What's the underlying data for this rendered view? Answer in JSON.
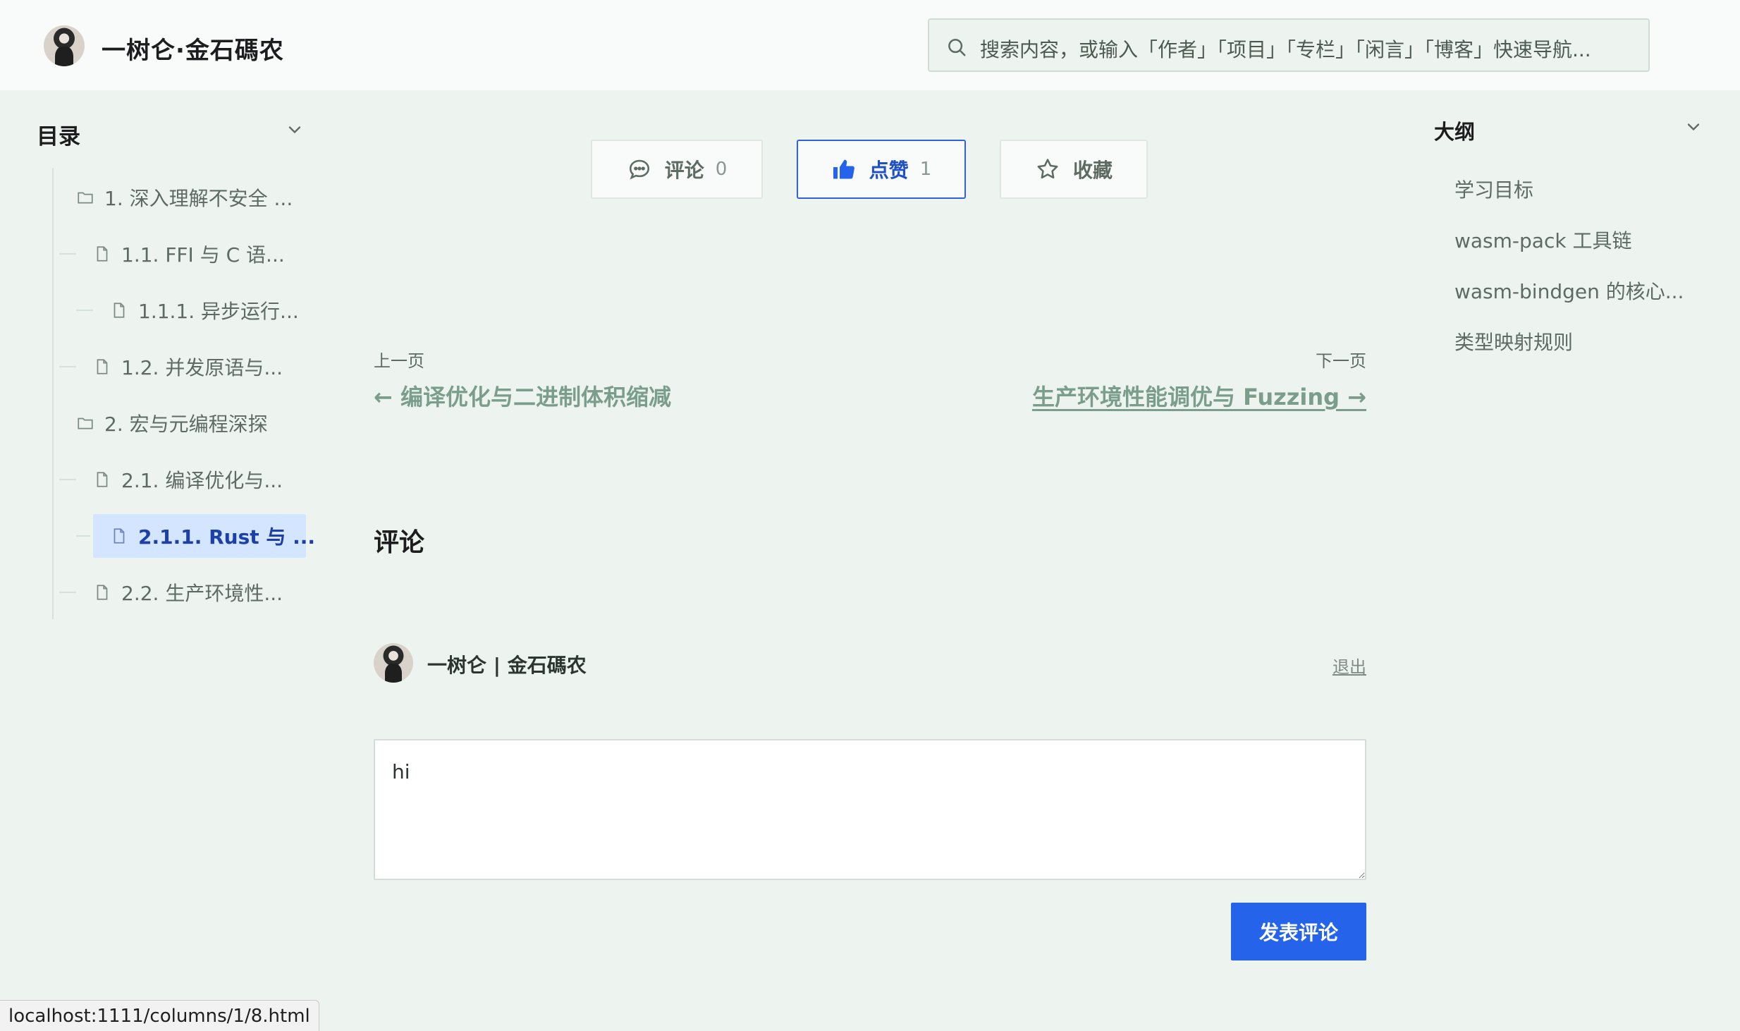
{
  "site": {
    "title": "一树仑·金石碼农"
  },
  "search": {
    "placeholder": "搜索内容，或输入「作者」「项目」「专栏」「闲言」「博客」快速导航..."
  },
  "toc": {
    "title": "目录",
    "items": [
      {
        "label": "1. 深入理解不安全 ...",
        "icon": "folder-icon"
      },
      {
        "label": "1.1. FFI 与 C 语...",
        "icon": "file-icon"
      },
      {
        "label": "1.1.1. 异步运行...",
        "icon": "file-icon"
      },
      {
        "label": "1.2. 并发原语与...",
        "icon": "file-icon"
      },
      {
        "label": "2. 宏与元编程深探",
        "icon": "folder-icon"
      },
      {
        "label": "2.1. 编译优化与...",
        "icon": "file-icon"
      },
      {
        "label": "2.1.1. Rust 与 ...",
        "icon": "file-icon",
        "active": true
      },
      {
        "label": "2.2. 生产环境性...",
        "icon": "file-icon"
      }
    ]
  },
  "outline": {
    "title": "大纲",
    "items": [
      "学习目标",
      "wasm-pack 工具链",
      "wasm-bindgen 的核心...",
      "类型映射规则"
    ]
  },
  "actions": {
    "comment": {
      "label": "评论",
      "count": "0"
    },
    "like": {
      "label": "点赞",
      "count": "1"
    },
    "favorite": {
      "label": "收藏"
    }
  },
  "pager": {
    "prev_caption": "上一页",
    "prev_title": "← 编译优化与二进制体积缩减",
    "next_caption": "下一页",
    "next_title": "生产环境性能调优与 Fuzzing →"
  },
  "comments": {
    "heading": "评论",
    "user_name": "一树仑 | 金石碼农",
    "logout_label": "退出",
    "draft": "hi",
    "submit_label": "发表评论"
  },
  "status_bar": {
    "url": "localhost:1111/columns/1/8.html"
  },
  "colors": {
    "accent": "#2563eb",
    "background": "#edf4ef",
    "link": "#7a9e8b",
    "active_bg": "#d4e6ff"
  }
}
